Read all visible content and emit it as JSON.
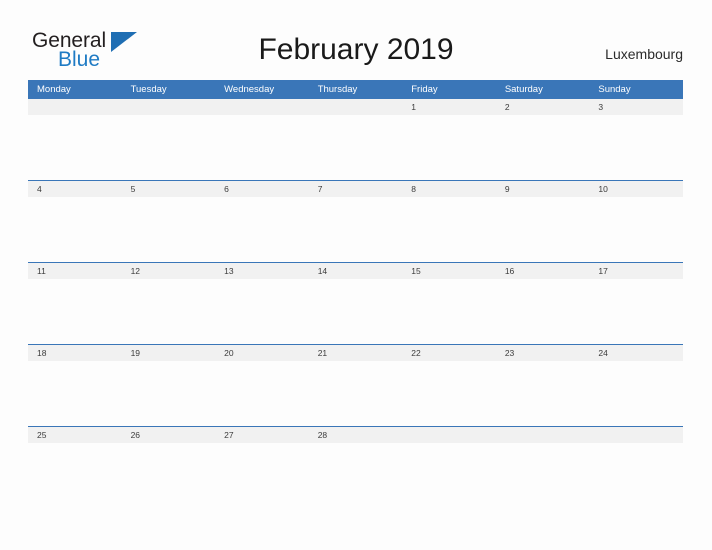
{
  "brand": {
    "name_part1": "General",
    "name_part2": "Blue",
    "triangle_icon": "blue-triangle-icon",
    "color_dark": "#231f20",
    "color_blue": "#1f7bc4"
  },
  "header": {
    "title": "February 2019",
    "region": "Luxembourg"
  },
  "calendar": {
    "month": "February",
    "year": "2019",
    "accent_color": "#3a76b8",
    "day_band_color": "#f1f1f1",
    "weekday_headers": [
      "Monday",
      "Tuesday",
      "Wednesday",
      "Thursday",
      "Friday",
      "Saturday",
      "Sunday"
    ],
    "weeks": [
      {
        "days": [
          "",
          "",
          "",
          "",
          "1",
          "2",
          "3"
        ]
      },
      {
        "days": [
          "4",
          "5",
          "6",
          "7",
          "8",
          "9",
          "10"
        ]
      },
      {
        "days": [
          "11",
          "12",
          "13",
          "14",
          "15",
          "16",
          "17"
        ]
      },
      {
        "days": [
          "18",
          "19",
          "20",
          "21",
          "22",
          "23",
          "24"
        ]
      },
      {
        "days": [
          "25",
          "26",
          "27",
          "28",
          "",
          "",
          ""
        ]
      }
    ]
  }
}
